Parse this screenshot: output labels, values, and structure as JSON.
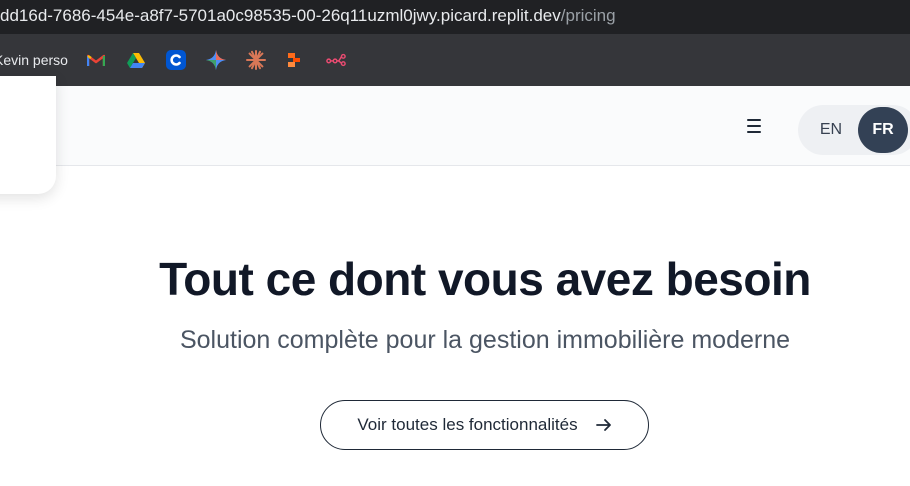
{
  "browser": {
    "url_host": "dd16d-7686-454e-a8f7-5701a0c98535-00-26q11uzml0jwy.picard.replit.dev",
    "url_path": "/pricing",
    "bookmarks_folder": "Kevin perso",
    "bookmark_icons": [
      "gmail-icon",
      "google-drive-icon",
      "coursera-icon",
      "gemini-icon",
      "claude-icon",
      "make-icon",
      "n8n-icon"
    ]
  },
  "header": {
    "menu_icon": "hamburger-icon",
    "languages": [
      {
        "label": "EN",
        "active": false
      },
      {
        "label": "FR",
        "active": true
      }
    ]
  },
  "hero": {
    "title": "Tout ce dont vous avez besoin",
    "subtitle": "Solution complète pour la gestion immobilière moderne",
    "cta_label": "Voir toutes les fonctionnalités",
    "cta_icon": "arrow-right-icon"
  },
  "colors": {
    "chrome_dark": "#202124",
    "bookmarks_bar": "#35363a",
    "active_lang": "#334155",
    "title": "#111827",
    "subtitle": "#4b5563"
  }
}
